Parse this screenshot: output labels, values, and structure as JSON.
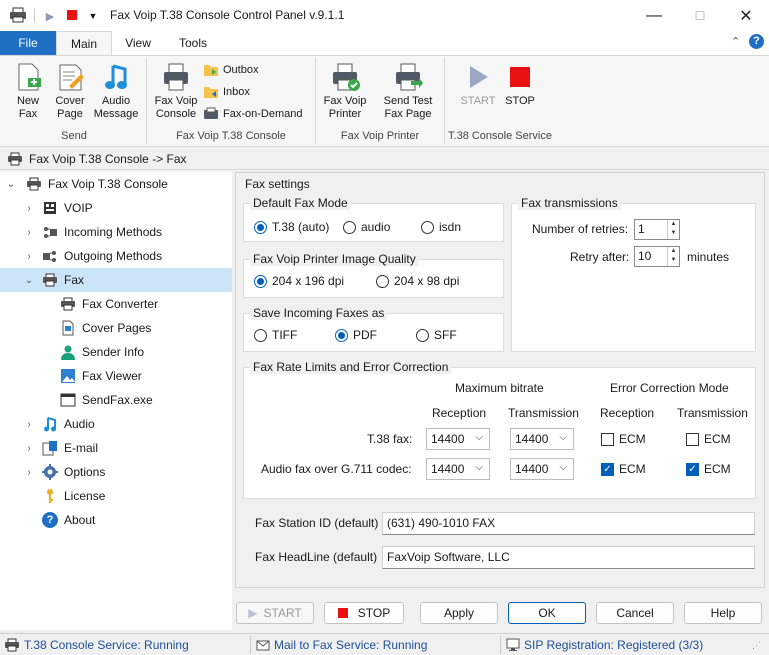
{
  "window": {
    "title": "Fax Voip T.38 Console Control Panel v.9.1.1"
  },
  "tabs": [
    {
      "label": "File"
    },
    {
      "label": "Main"
    },
    {
      "label": "View"
    },
    {
      "label": "Tools"
    }
  ],
  "ribbon": {
    "send": {
      "new_fax": "New\nFax",
      "cover_page": "Cover\nPage",
      "audio_message": "Audio\nMessage",
      "group": "Send"
    },
    "console": {
      "fax_voip_console": "Fax Voip\nConsole",
      "outbox": "Outbox",
      "inbox": "Inbox",
      "fax_on_demand": "Fax-on-Demand",
      "group": "Fax Voip T.38 Console"
    },
    "printer": {
      "fax_voip_printer": "Fax Voip\nPrinter",
      "send_test": "Send Test\nFax Page",
      "group": "Fax Voip Printer"
    },
    "service": {
      "start": "START",
      "stop": "STOP",
      "group": "T.38 Console Service"
    }
  },
  "path": "Fax Voip T.38 Console -> Fax",
  "tree": {
    "root": "Fax Voip T.38 Console",
    "items": [
      "VOIP",
      "Incoming Methods",
      "Outgoing Methods",
      "Fax",
      "Fax Converter",
      "Cover Pages",
      "Sender Info",
      "Fax Viewer",
      "SendFax.exe",
      "Audio",
      "E-mail",
      "Options",
      "License",
      "About"
    ]
  },
  "fax_settings": {
    "title": "Fax settings",
    "mode": {
      "title": "Default Fax Mode",
      "options": [
        "T.38 (auto)",
        "audio",
        "isdn"
      ],
      "selected": "T.38 (auto)"
    },
    "quality": {
      "title": "Fax Voip Printer Image Quality",
      "options": [
        "204 x 196 dpi",
        "204 x 98 dpi"
      ],
      "selected": "204 x 196 dpi"
    },
    "save_as": {
      "title": "Save Incoming Faxes as",
      "options": [
        "TIFF",
        "PDF",
        "SFF"
      ],
      "selected": "PDF"
    },
    "transmissions": {
      "title": "Fax transmissions",
      "retries_label": "Number of retries:",
      "retries": "1",
      "retry_after_label": "Retry after:",
      "retry_after": "10",
      "minutes": "minutes"
    },
    "rate": {
      "title": "Fax Rate Limits and Error Correction",
      "max_bitrate": "Maximum bitrate",
      "ecm_mode": "Error Correction Mode",
      "reception": "Reception",
      "transmission": "Transmission",
      "rows": [
        {
          "label": "T.38 fax:",
          "rx": "14400",
          "tx": "14400",
          "ecm_rx": "ECM",
          "ecm_rx_checked": false,
          "ecm_tx": "ECM",
          "ecm_tx_checked": false
        },
        {
          "label": "Audio fax over G.711 codec:",
          "rx": "14400",
          "tx": "14400",
          "ecm_rx": "ECM",
          "ecm_rx_checked": true,
          "ecm_tx": "ECM",
          "ecm_tx_checked": true
        }
      ]
    },
    "station_id_label": "Fax Station ID (default)",
    "station_id": "(631) 490-1010 FAX",
    "headline_label": "Fax HeadLine (default)",
    "headline": "FaxVoip Software, LLC"
  },
  "buttons": {
    "start": "START",
    "stop": "STOP",
    "apply": "Apply",
    "ok": "OK",
    "cancel": "Cancel",
    "help": "Help"
  },
  "status": [
    {
      "text": "T.38 Console Service: Running"
    },
    {
      "text": "Mail to Fax Service: Running"
    },
    {
      "text": "SIP Registration: Registered (3/3)"
    }
  ],
  "colors": {
    "accent": "#005fb8",
    "file_tab": "#1f6fc5",
    "stop_red": "#e81010",
    "start_gray": "#9aa8c4",
    "tree_selected": "#cce4f7"
  }
}
